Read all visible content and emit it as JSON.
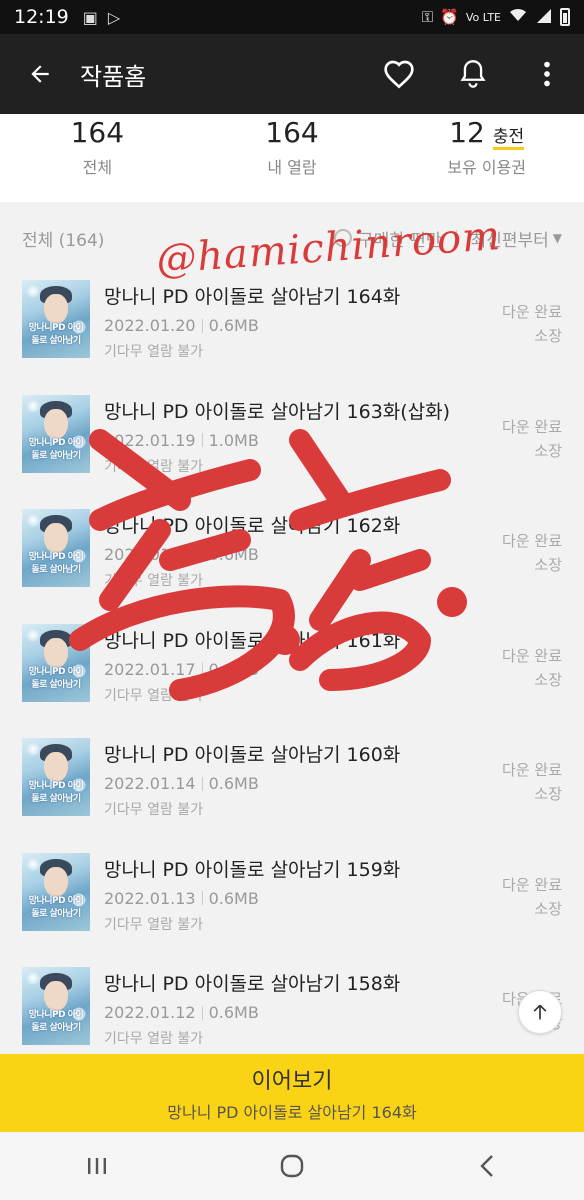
{
  "status_bar": {
    "time": "12:19",
    "network_label": "Vo LTE",
    "signal_icons": [
      "image-icon",
      "play-store-icon",
      "key-icon",
      "alarm-icon",
      "wifi-icon",
      "signal-icon",
      "battery-icon"
    ]
  },
  "app_bar": {
    "title": "작품홈",
    "icons": [
      "back-arrow-icon",
      "heart-icon",
      "bell-icon",
      "more-vertical-icon"
    ]
  },
  "stats": {
    "total": {
      "value": "164",
      "label": "전체"
    },
    "viewed": {
      "value": "164",
      "label": "내 열람"
    },
    "tickets": {
      "value": "12",
      "label": "보유 이용권",
      "action": "충전"
    }
  },
  "list_header": {
    "count_label": "전체 (164)",
    "purchased_label": "구매한 편만",
    "sort_label": "최신편부터"
  },
  "episodes": [
    {
      "title": "망나니 PD 아이돌로 살아남기 164화",
      "date": "2022.01.20",
      "size": "0.6MB",
      "wait": "기다무 열람 불가",
      "status1": "다운 완료",
      "status2": "소장"
    },
    {
      "title": "망나니 PD 아이돌로 살아남기 163화(삽화)",
      "date": "2022.01.19",
      "size": "1.0MB",
      "wait": "기다무 열람 불가",
      "status1": "다운 완료",
      "status2": "소장"
    },
    {
      "title": "망나니 PD 아이돌로 살아남기 162화",
      "date": "2022.01.18",
      "size": "0.6MB",
      "wait": "기다무 열람 불가",
      "status1": "다운 완료",
      "status2": "소장"
    },
    {
      "title": "망나니 PD 아이돌로 살아남기 161화",
      "date": "2022.01.17",
      "size": "0.6MB",
      "wait": "기다무 열람 불가",
      "status1": "다운 완료",
      "status2": "소장"
    },
    {
      "title": "망나니 PD 아이돌로 살아남기 160화",
      "date": "2022.01.14",
      "size": "0.6MB",
      "wait": "기다무 열람 불가",
      "status1": "다운 완료",
      "status2": "소장"
    },
    {
      "title": "망나니 PD 아이돌로 살아남기 159화",
      "date": "2022.01.13",
      "size": "0.6MB",
      "wait": "기다무 열람 불가",
      "status1": "다운 완료",
      "status2": "소장"
    },
    {
      "title": "망나니 PD 아이돌로 살아남기 158화",
      "date": "2022.01.12",
      "size": "0.6MB",
      "wait": "기다무 열람 불가",
      "status1": "다운 완료",
      "status2": "소장"
    }
  ],
  "thumbnail_text": "망나니PD 아이돌로 살아남기",
  "continue_bar": {
    "label": "이어보기",
    "episode": "망나니 PD 아이돌로 살아남기 164화"
  },
  "nav_bar": {
    "icons": [
      "recent-apps-icon",
      "home-icon",
      "back-icon"
    ]
  },
  "watermark": {
    "text": "@hamichinroom",
    "handwritten": "총.총.",
    "color": "#d93a3a"
  },
  "colors": {
    "accent_yellow": "#fbd315",
    "app_bar": "#212121",
    "watermark_red": "#d93a3a"
  }
}
